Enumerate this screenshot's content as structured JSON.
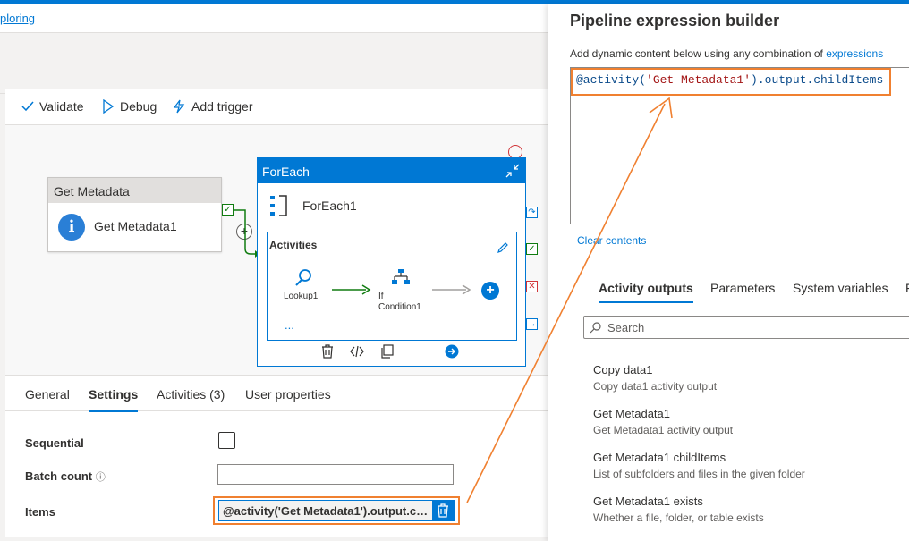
{
  "top_link": "ploring",
  "toolbar": {
    "validate": "Validate",
    "debug": "Debug",
    "add_trigger": "Add trigger"
  },
  "canvas": {
    "get_metadata_header": "Get Metadata",
    "get_metadata_name": "Get Metadata1",
    "foreach_header": "ForEach",
    "foreach_name": "ForEach1",
    "activities_label": "Activities",
    "lookup_label": "Lookup1",
    "if_label_line1": "If",
    "if_label_line2": "Condition1",
    "more": "..."
  },
  "bottom_tabs": [
    {
      "label": "General"
    },
    {
      "label": "Settings"
    },
    {
      "label": "Activities (3)"
    },
    {
      "label": "User properties"
    }
  ],
  "settings": {
    "sequential_label": "Sequential",
    "batch_count_label": "Batch count",
    "info_glyph": "ⓘ",
    "items_label": "Items",
    "items_value": "@activity('Get Metadata1').output.childItems"
  },
  "builder": {
    "title": "Pipeline expression builder",
    "subtitle": "Add dynamic content below using any combination of",
    "subtitle_link": "expressions",
    "expr_prefix": "@activity(",
    "expr_string": "'Get Metadata1'",
    "expr_suffix": ").output.childItems",
    "clear_contents": "Clear contents",
    "tabs": [
      {
        "label": "Activity outputs"
      },
      {
        "label": "Parameters"
      },
      {
        "label": "System variables"
      },
      {
        "label": "F"
      }
    ],
    "search_placeholder": "Search",
    "activity_outputs": [
      {
        "title": "Copy data1",
        "desc": "Copy data1 activity output"
      },
      {
        "title": "Get Metadata1",
        "desc": "Get Metadata1 activity output"
      },
      {
        "title": "Get Metadata1 childItems",
        "desc": "List of subfolders and files in the given folder"
      },
      {
        "title": "Get Metadata1 exists",
        "desc": "Whether a file, folder, or table exists"
      }
    ]
  },
  "colors": {
    "accent": "#0078d4",
    "highlight": "#f08030",
    "success": "#107c10",
    "error": "#d13438"
  }
}
